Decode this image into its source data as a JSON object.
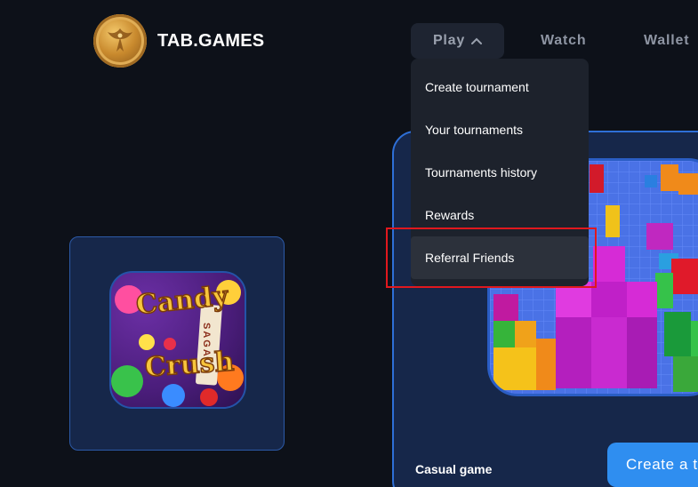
{
  "header": {
    "brand": "TAB.GAMES",
    "logo_icon": "phoenix-coin-icon",
    "nav": {
      "play_label": "Play",
      "play_icon": "chevron-up-icon",
      "watch_label": "Watch",
      "wallet_label": "Wallet"
    }
  },
  "dropdown": {
    "items": [
      {
        "label": "Create tournament"
      },
      {
        "label": "Your tournaments"
      },
      {
        "label": "Tournaments history"
      },
      {
        "label": "Rewards"
      },
      {
        "label": "Referral Friends"
      }
    ],
    "highlight_color": "#e0181e"
  },
  "games": [
    {
      "name": "Candy Crush Saga",
      "thumb_text_1": "Candy",
      "thumb_text_2": "Crush",
      "thumb_text_3": "SAGA"
    },
    {
      "name": "Tetris",
      "category": "Casual game"
    }
  ],
  "create_button_label": "Create a t",
  "colors": {
    "background": "#0d1119",
    "card": "#16274a",
    "accent": "#2f8ef0"
  }
}
